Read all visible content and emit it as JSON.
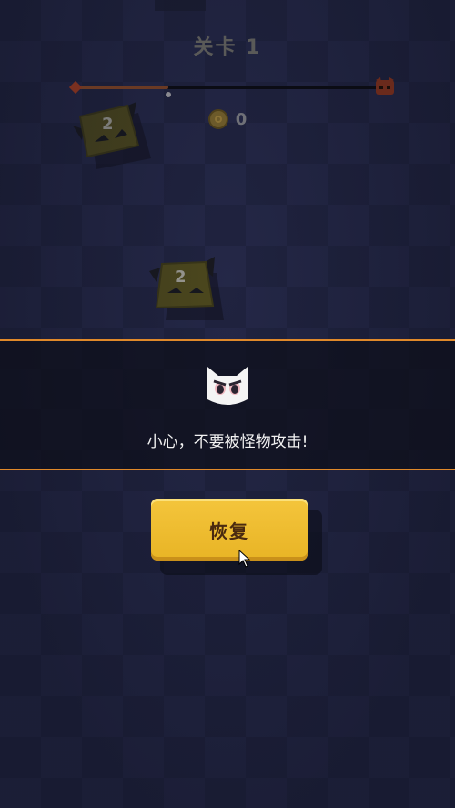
{
  "level": {
    "title": "关卡 1"
  },
  "progress": {
    "value": 0.3
  },
  "coins": {
    "count": "0"
  },
  "enemies": [
    {
      "label": "2"
    },
    {
      "label": "2"
    }
  ],
  "alert": {
    "message": "小心，不要被怪物攻击!"
  },
  "restore_button": {
    "label": "恢复"
  },
  "colors": {
    "accent": "#e0892a",
    "button": "#f0c030",
    "background": "#262a4c"
  }
}
